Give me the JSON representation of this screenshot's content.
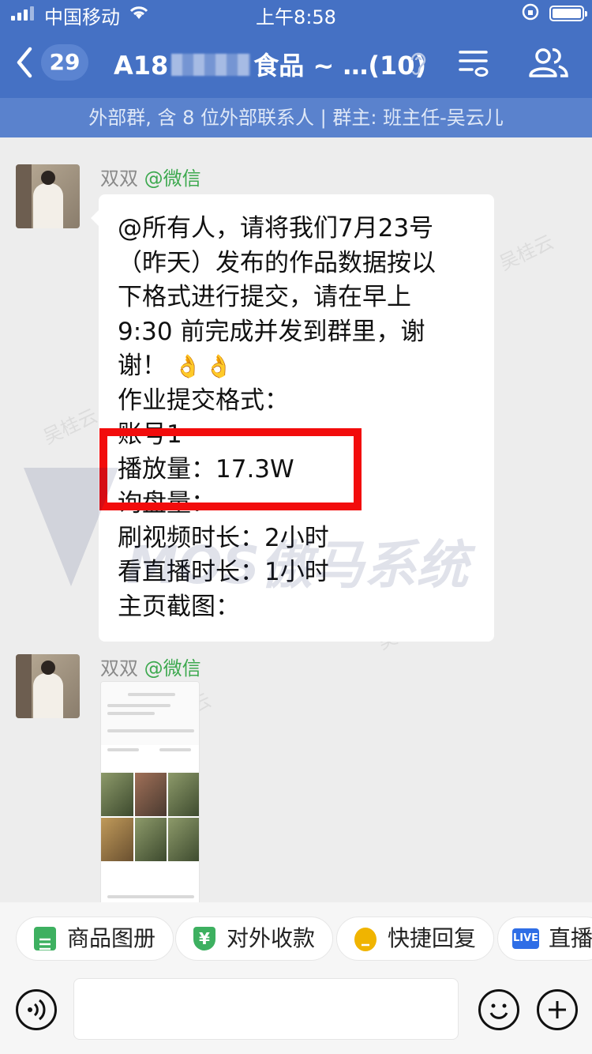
{
  "status_bar": {
    "carrier": "中国移动",
    "time": "上午8:58"
  },
  "nav": {
    "unread_count": "29",
    "title_prefix": "A18",
    "title_suffix": "食品 ~ …(10)"
  },
  "group_info": "外部群, 含 8 位外部联系人 | 群主: 班主任-吴云儿",
  "messages": [
    {
      "sender": "双双",
      "via": "@微信",
      "lines": [
        "@所有人，请将我们7月23号",
        "（昨天）发布的作品数据按以",
        "下格式进行提交，请在早上",
        "9:30 前完成并发到群里，谢",
        "谢！",
        "作业提交格式：",
        "账号1",
        "播放量：17.3W",
        "询盘量：",
        "刷视频时长：2小时",
        "看直播时长：1小时",
        "主页截图："
      ],
      "emoji": "👌👌"
    },
    {
      "sender": "双双",
      "via": "@微信",
      "type": "image"
    }
  ],
  "watermarks": {
    "name": "吴桂云",
    "brand": "MOS傲马系统"
  },
  "quick_actions": [
    {
      "label": "商品图册",
      "icon": "album-icon",
      "color": "#3db060"
    },
    {
      "label": "对外收款",
      "icon": "payment-icon",
      "color": "#3db060"
    },
    {
      "label": "快捷回复",
      "icon": "quick-reply-icon",
      "color": "#f0b400"
    },
    {
      "label": "直播",
      "icon": "live-icon",
      "color": "#2f6ee6",
      "badge": "LIVE"
    }
  ]
}
